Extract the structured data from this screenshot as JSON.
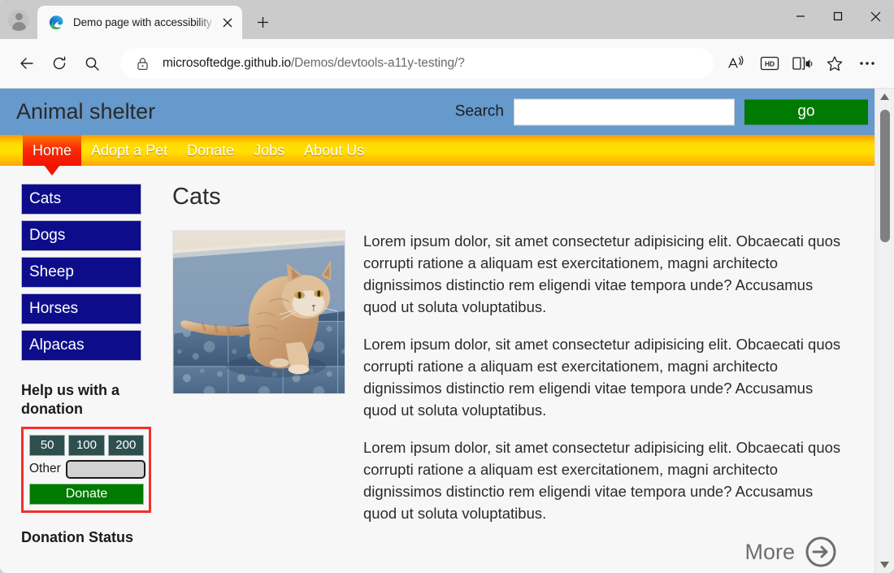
{
  "browser": {
    "tab": {
      "title": "Demo page with accessibility issu",
      "favicon_name": "edge-logo-icon",
      "close_label": "✕",
      "new_tab_label": "+"
    },
    "window_controls": {
      "minimize": "─",
      "maximize": "□",
      "close": "✕"
    },
    "toolbar": {
      "back_label": "←",
      "refresh_label": "↻",
      "search_label": "search-icon",
      "url_host": "microsoftedge.github.io",
      "url_path": "/Demos/devtools-a11y-testing/?",
      "lock_icon": "lock-icon",
      "read_aloud": "A",
      "hd_badge": "HD",
      "immersive_reader": "immersive-reader-icon",
      "favorites": "star-icon",
      "settings_more": "•••"
    }
  },
  "site": {
    "title": "Animal shelter",
    "search": {
      "label": "Search",
      "value": "",
      "placeholder": "",
      "button": "go"
    },
    "nav": [
      {
        "label": "Home",
        "active": true
      },
      {
        "label": "Adopt a Pet",
        "active": false
      },
      {
        "label": "Donate",
        "active": false
      },
      {
        "label": "Jobs",
        "active": false
      },
      {
        "label": "About Us",
        "active": false
      }
    ],
    "sidebar": {
      "categories": [
        "Cats",
        "Dogs",
        "Sheep",
        "Horses",
        "Alpacas"
      ],
      "donation": {
        "heading": "Help us with a donation",
        "amounts": [
          "50",
          "100",
          "200"
        ],
        "other_label": "Other",
        "other_value": "",
        "donate_button": "Donate"
      },
      "status_heading": "Donation Status"
    },
    "main": {
      "heading": "Cats",
      "image_alt": "photo of a fluffy ginger cat sitting on blue tiles",
      "paragraphs": [
        "Lorem ipsum dolor, sit amet consectetur adipisicing elit. Obcaecati quos corrupti ratione a aliquam est exercitationem, magni architecto dignissimos distinctio rem eligendi vitae tempora unde? Accusamus quod ut soluta voluptatibus.",
        "Lorem ipsum dolor, sit amet consectetur adipisicing elit. Obcaecati quos corrupti ratione a aliquam est exercitationem, magni architecto dignissimos distinctio rem eligendi vitae tempora unde? Accusamus quod ut soluta voluptatibus.",
        "Lorem ipsum dolor, sit amet consectetur adipisicing elit. Obcaecati quos corrupti ratione a aliquam est exercitationem, magni architecto dignissimos distinctio rem eligendi vitae tempora unde? Accusamus quod ut soluta voluptatibus."
      ],
      "more_label": "More"
    }
  },
  "colors": {
    "banner_blue": "#6699cc",
    "nav_yellow": "#ffe200",
    "nav_active_red": "#f11404",
    "category_navy": "#0d0d8c",
    "donate_green": "#017a01",
    "amount_teal": "#2f4f4f",
    "alert_border_red": "#f2302e"
  }
}
